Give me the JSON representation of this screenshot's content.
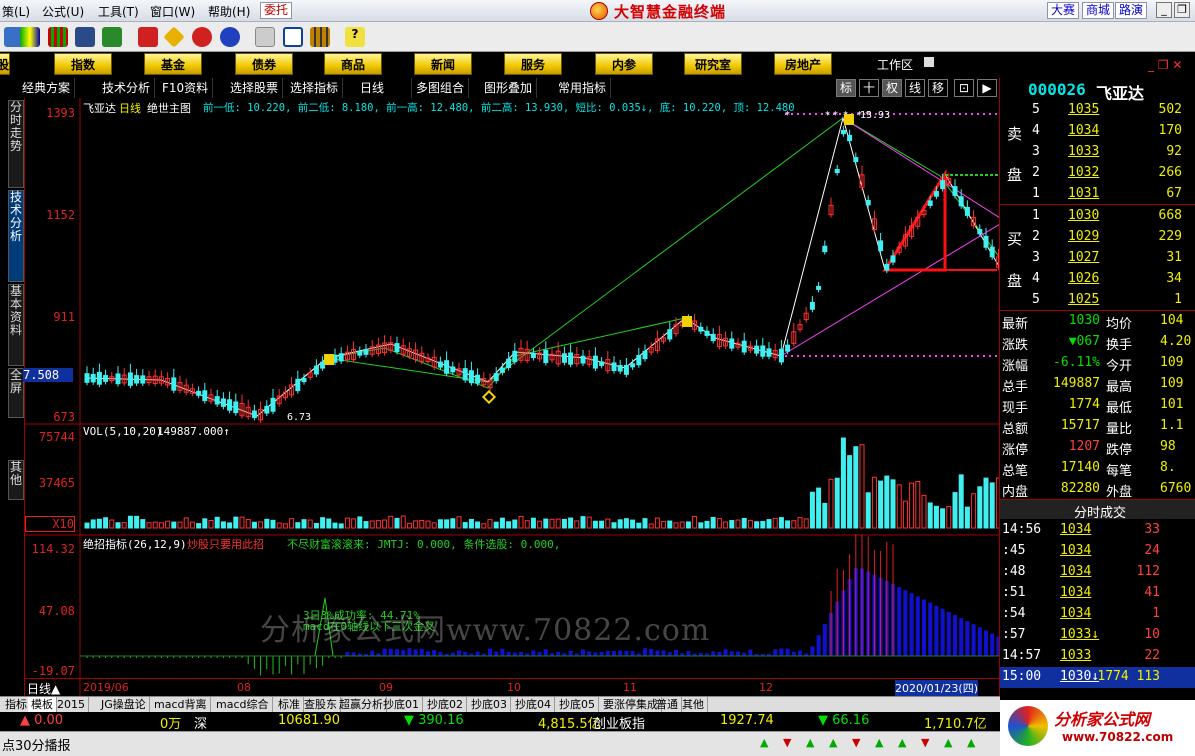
{
  "menu": {
    "items": [
      "策(L)",
      "公式(U)",
      "工具(T)",
      "窗口(W)",
      "帮助(H)"
    ],
    "trade_button": "委托",
    "app_title": "大智慧金融终端",
    "top_right": [
      "大赛",
      "商城",
      "路演"
    ]
  },
  "nav": {
    "buttons": [
      "股",
      "指数",
      "基金",
      "债券",
      "商品",
      "新闻",
      "服务",
      "内参",
      "研究室",
      "房地产"
    ],
    "workarea": "工作区"
  },
  "toolrow": {
    "items": [
      "经典方案",
      "技术分析",
      "F10资料",
      "选择股票",
      "选择指标",
      "日线",
      "多图组合",
      "图形叠加",
      "常用指标"
    ],
    "mode_buttons": [
      "标",
      "十",
      "权",
      "线",
      "移"
    ]
  },
  "side_tabs": [
    "分时走势",
    "技术分析",
    "基本资料",
    "全屏",
    "其他"
  ],
  "chart": {
    "main_header": {
      "name": "飞亚达",
      "period": "日线",
      "indicator": "绝世主图",
      "text": "前一低: 10.220, 前二低: 8.180, 前一高: 12.480, 前二高: 13.930, 短比: 0.035↓, 底: 10.220, 顶: 12.480"
    },
    "price_axis": [
      "1393",
      "1152",
      "911",
      "7.508",
      "673"
    ],
    "high_label": "13.93",
    "low_label": "6.73",
    "vol_header": "VOL(5,10,20)",
    "vol_value": "149887.000↑",
    "vol_axis": [
      "75744",
      "37465",
      "X10"
    ],
    "ind_header": "绝招指标(26,12,9)",
    "ind_text": "炒股只要用此招",
    "ind_text2": "不尽财富滚滚来: JMTJ: 0.000, 条件选股: 0.000,",
    "ind_axis": [
      "114.32",
      "47.08",
      "-19.07"
    ],
    "annot1": "3日3%成功率: 44.71%",
    "annot2": "macd在0轴线以下三次金叉",
    "watermark": "分析家公式网www.70822.com",
    "x_axis": [
      "2019/06",
      "08",
      "09",
      "10",
      "11",
      "12"
    ],
    "x_axis_date": "2020/01/23(四)",
    "period_label": "日线▲"
  },
  "quote": {
    "code": "000026",
    "name": "飞亚达",
    "sell": [
      {
        "n": "5",
        "p": "1035",
        "v": "502"
      },
      {
        "n": "4",
        "p": "1034",
        "v": "170"
      },
      {
        "n": "3",
        "p": "1033",
        "v": "92"
      },
      {
        "n": "2",
        "p": "1032",
        "v": "266"
      },
      {
        "n": "1",
        "p": "1031",
        "v": "67"
      }
    ],
    "sell_label": [
      "卖",
      "盘"
    ],
    "buy_label": [
      "买",
      "盘"
    ],
    "buy": [
      {
        "n": "1",
        "p": "1030",
        "v": "668"
      },
      {
        "n": "2",
        "p": "1029",
        "v": "229"
      },
      {
        "n": "3",
        "p": "1027",
        "v": "31"
      },
      {
        "n": "4",
        "p": "1026",
        "v": "34"
      },
      {
        "n": "5",
        "p": "1025",
        "v": "1"
      }
    ],
    "stats": [
      [
        "最新",
        "1030",
        "均价",
        "104"
      ],
      [
        "涨跌",
        "▼067",
        "换手",
        "4.20"
      ],
      [
        "涨幅",
        "-6.11%",
        "今开",
        "109"
      ],
      [
        "总手",
        "149887",
        "最高",
        "109"
      ],
      [
        "现手",
        "1774",
        "最低",
        "101"
      ],
      [
        "总额",
        "15717",
        "量比",
        "1.1"
      ],
      [
        "涨停",
        "1207",
        "跌停",
        "98"
      ],
      [
        "总笔",
        "17140",
        "每笔",
        "8."
      ],
      [
        "内盘",
        "82280",
        "外盘",
        "6760"
      ]
    ],
    "ticks_title": "分时成交",
    "ticks": [
      [
        "14:56",
        "1034",
        "33"
      ],
      [
        ":45",
        "1034",
        "24"
      ],
      [
        ":48",
        "1034",
        "112"
      ],
      [
        ":51",
        "1034",
        "41"
      ],
      [
        ":54",
        "1034",
        "1"
      ],
      [
        ":57",
        "1033↓",
        "10"
      ],
      [
        "14:57",
        "1033",
        "22"
      ],
      [
        "15:00",
        "1030↓",
        "1774 113"
      ]
    ]
  },
  "bottom_tabs": [
    "指标",
    "模板",
    "2015",
    "JG操盘论",
    "macd背离",
    "macd综合",
    "标准",
    "查股东",
    "超赢分析",
    "抄底01",
    "抄底02",
    "抄底03",
    "抄底04",
    "抄底05",
    "要涨停集成",
    "普通",
    "其他"
  ],
  "status": {
    "a": "▲ 0.00",
    "b": "0万",
    "c": "深",
    "d": "10681.90",
    "e": "▼ 390.16",
    "f": "4,815.5亿",
    "g": "创业板指",
    "h": "1927.74",
    "i": "▼ 66.16",
    "j": "1,710.7亿"
  },
  "bottom": {
    "text": "点30分播报"
  },
  "brand": {
    "text": "分析家公式网",
    "url": "www.70822.com"
  }
}
